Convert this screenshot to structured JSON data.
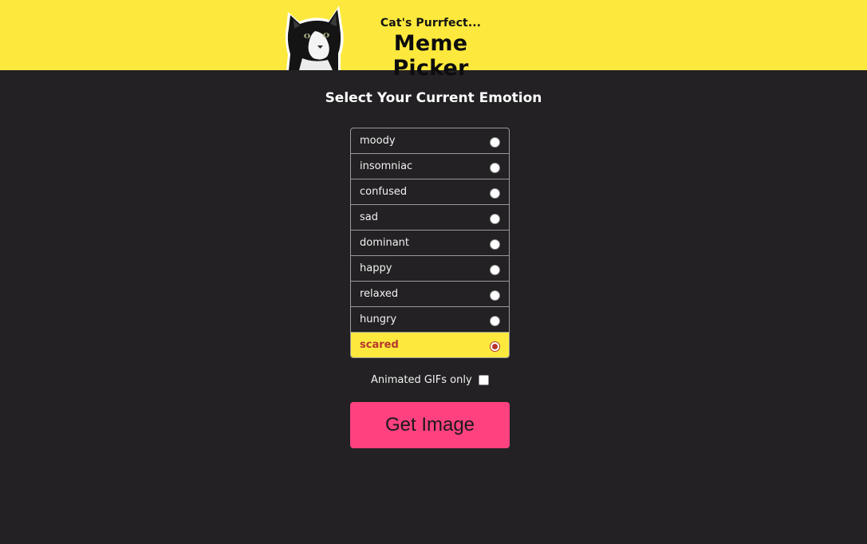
{
  "header": {
    "subtitle": "Cat's Purrfect...",
    "title": "Meme Picker"
  },
  "main": {
    "section_title": "Select Your Current Emotion",
    "emotions": [
      {
        "label": "moody",
        "selected": false
      },
      {
        "label": "insomniac",
        "selected": false
      },
      {
        "label": "confused",
        "selected": false
      },
      {
        "label": "sad",
        "selected": false
      },
      {
        "label": "dominant",
        "selected": false
      },
      {
        "label": "happy",
        "selected": false
      },
      {
        "label": "relaxed",
        "selected": false
      },
      {
        "label": "hungry",
        "selected": false
      },
      {
        "label": "scared",
        "selected": true
      }
    ],
    "gifs_only_label": "Animated GIFs only",
    "gifs_only_checked": false,
    "button_label": "Get Image"
  },
  "colors": {
    "background": "#232123",
    "header_bg": "#fde93d",
    "selected_bg": "#fde93d",
    "selected_text": "#b5362d",
    "button_bg": "#ff4180"
  },
  "icons": {
    "logo": "cat-logo-icon"
  }
}
